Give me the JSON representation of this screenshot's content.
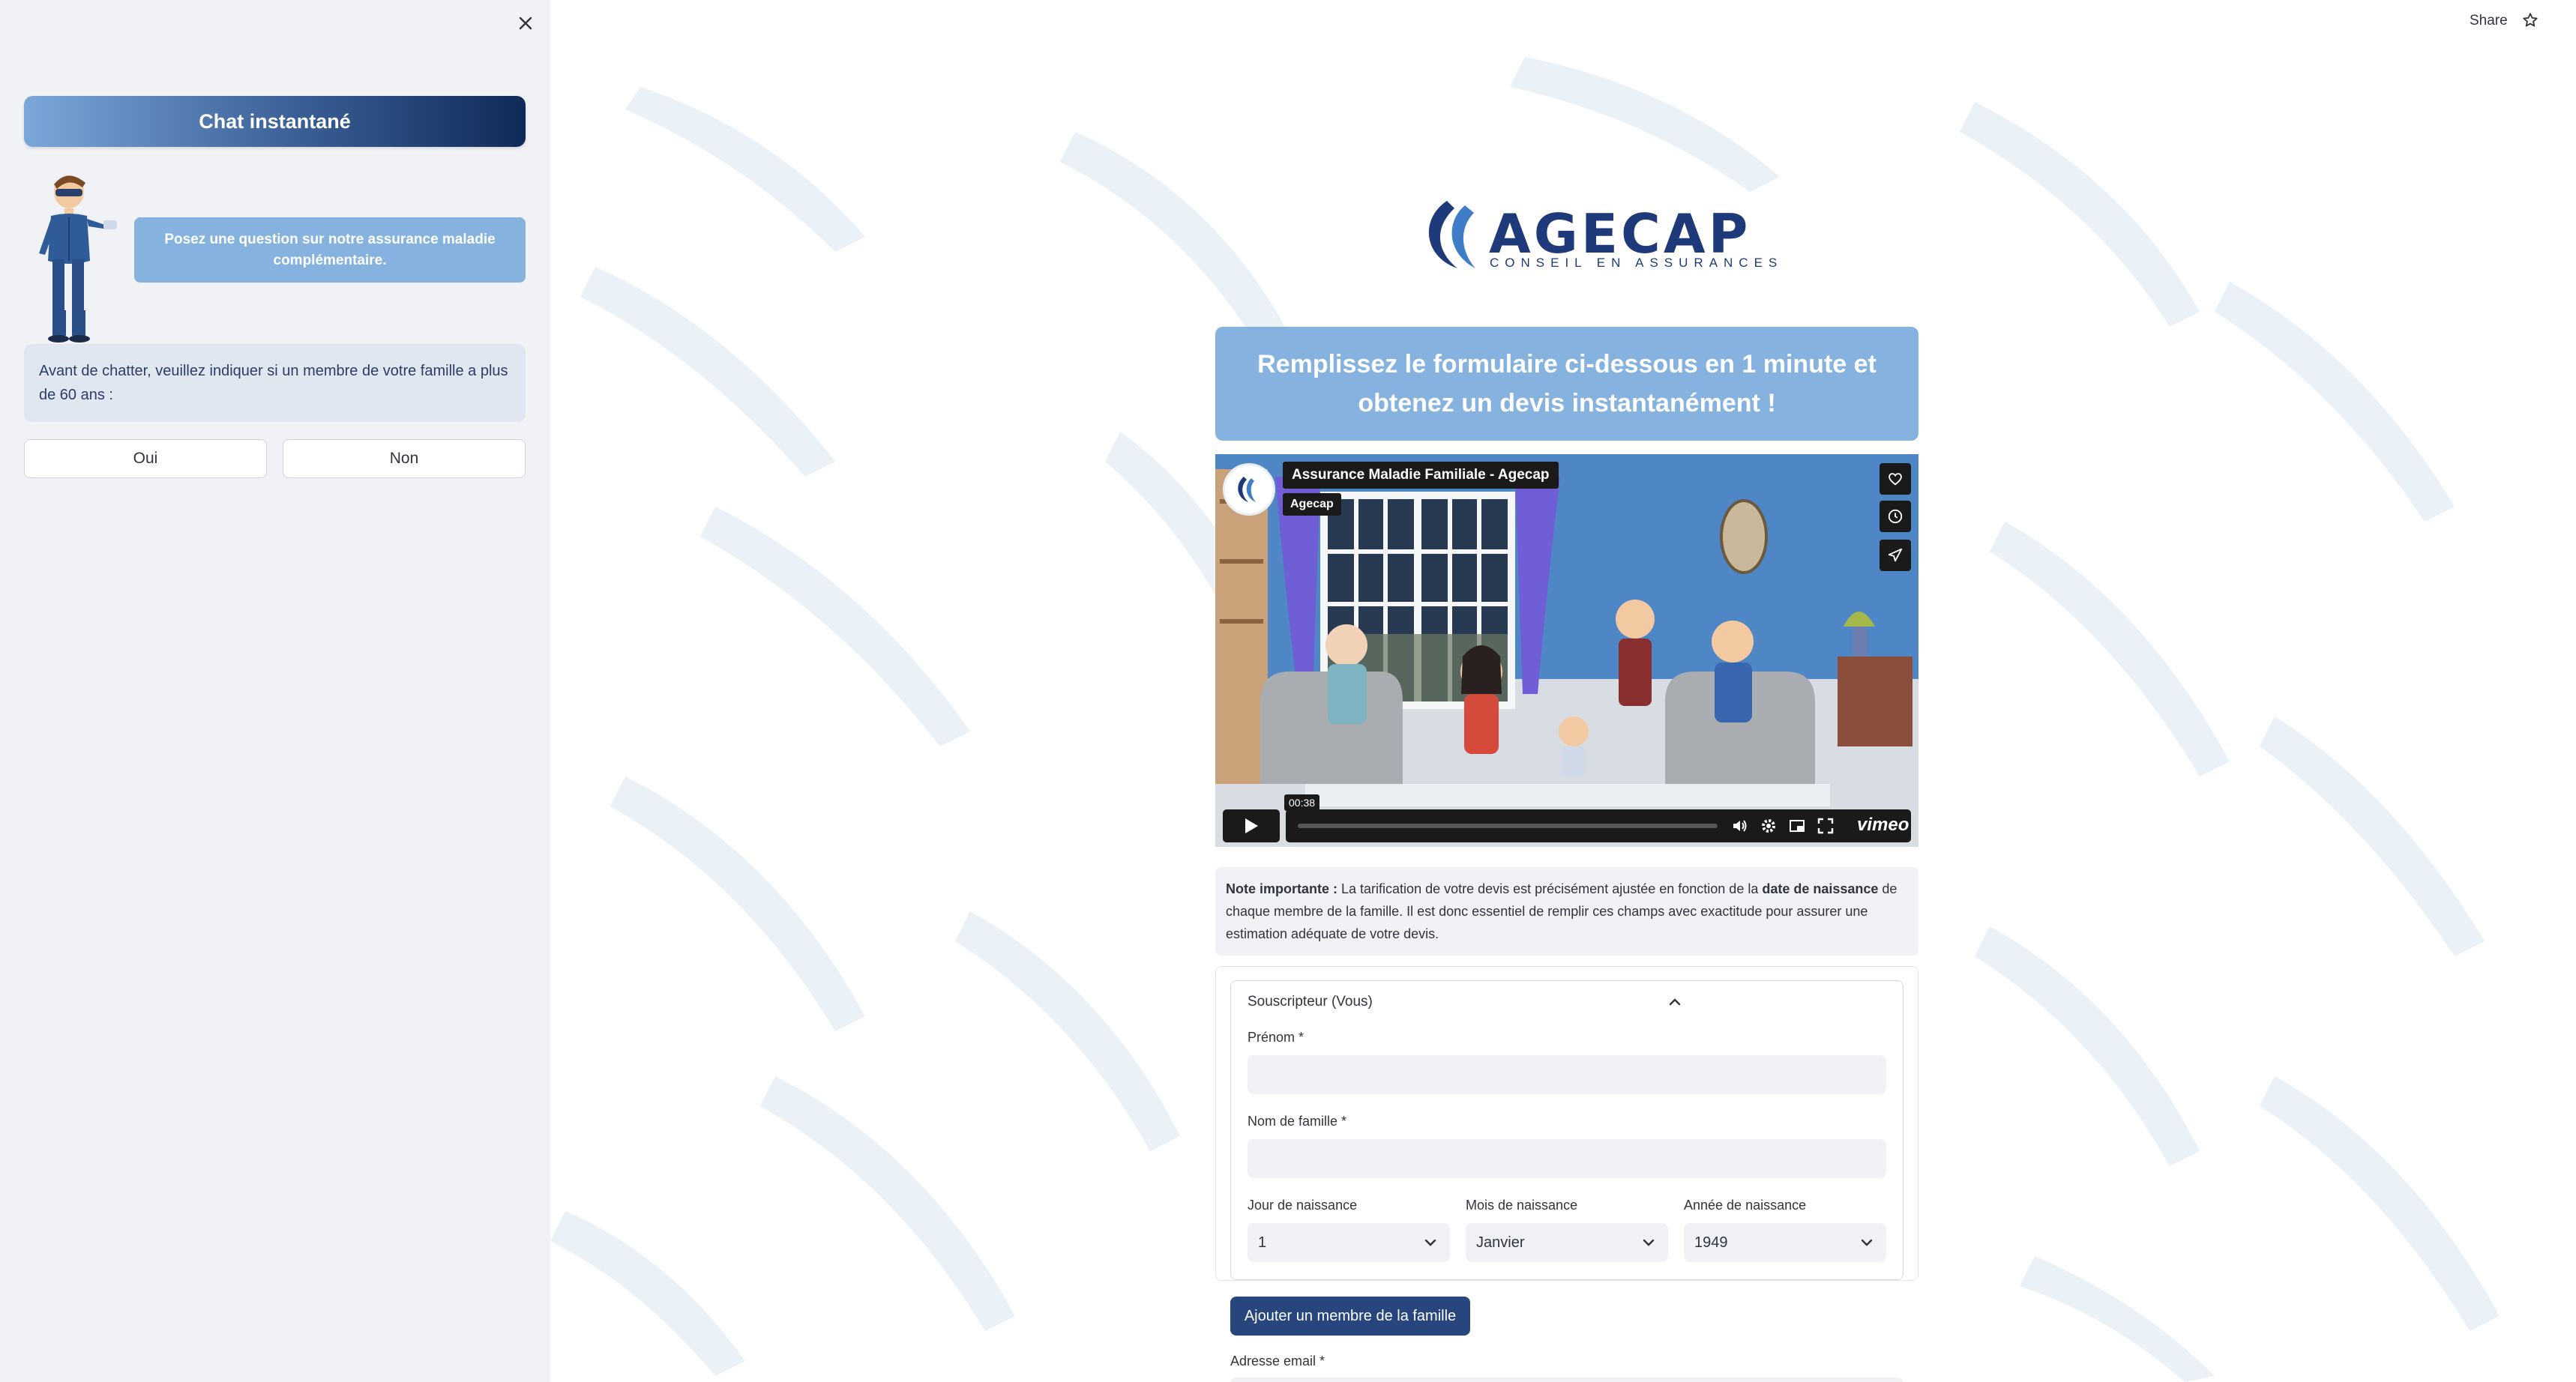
{
  "sidebar": {
    "chat_title": "Chat instantané",
    "bot_message": "Posez une question sur notre assurance maladie complémentaire.",
    "question": "Avant de chatter, veuillez indiquer si un membre de votre famille a plus de 60 ans :",
    "yes_label": "Oui",
    "no_label": "Non"
  },
  "toolbar": {
    "share_label": "Share"
  },
  "logo": {
    "name": "AGECAP",
    "tagline": "CONSEIL EN ASSURANCES"
  },
  "banner": {
    "text": "Remplissez le formulaire ci-dessous en 1 minute et obtenez un devis instantanément !"
  },
  "video": {
    "title": "Assurance Maladie Familiale - Agecap",
    "channel": "Agecap",
    "time": "00:38",
    "provider": "vimeo"
  },
  "note": {
    "prefix": "Note importante :",
    "text_1": " La tarification de votre devis est précisément ajustée en fonction de la ",
    "bold_2": "date de naissance",
    "text_3": " de chaque membre de la famille. Il est donc essentiel de remplir ces champs avec exactitude pour assurer une estimation adéquate de votre devis."
  },
  "form": {
    "section_title": "Souscripteur (Vous)",
    "first_name_label": "Prénom *",
    "last_name_label": "Nom de famille *",
    "day_label": "Jour de naissance",
    "month_label": "Mois de naissance",
    "year_label": "Année de naissance",
    "day_value": "1",
    "month_value": "Janvier",
    "year_value": "1949",
    "add_member_label": "Ajouter un membre de la famille",
    "email_label": "Adresse email *"
  },
  "colors": {
    "accent_dark": "#27467e",
    "banner_blue": "#86b2e0",
    "sidebar_bg": "#f0f2f6"
  }
}
